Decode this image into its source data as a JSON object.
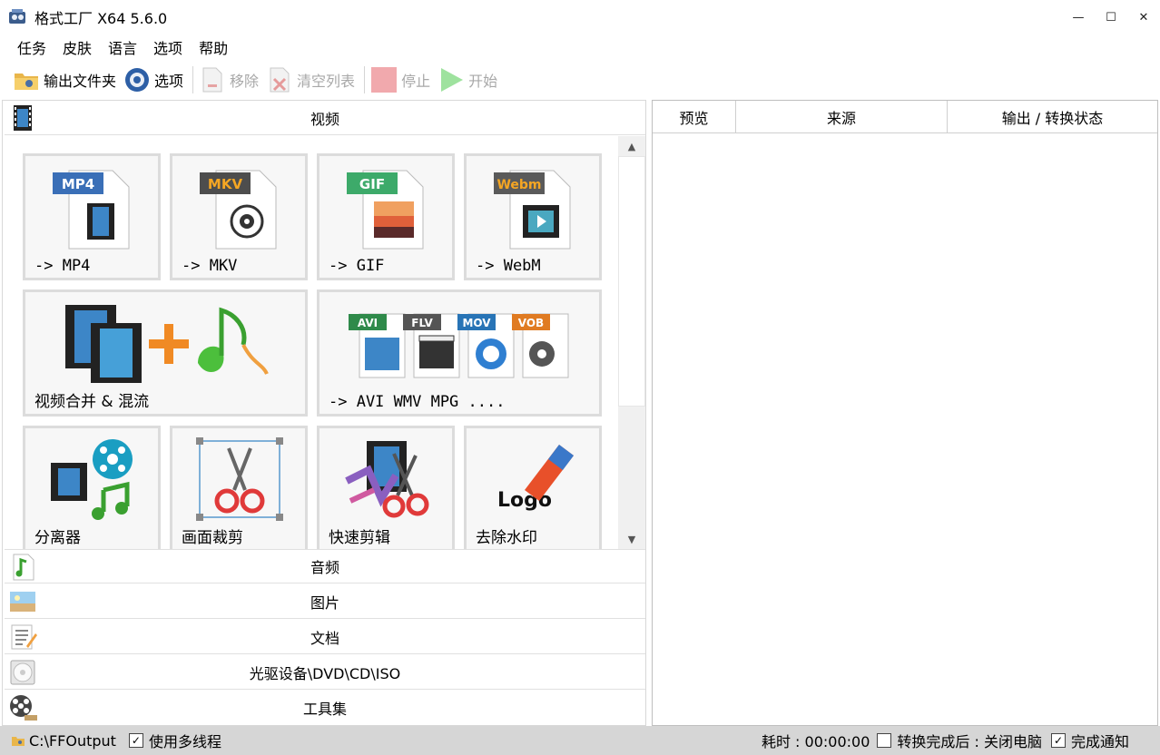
{
  "window": {
    "title": "格式工厂 X64 5.6.0",
    "minimize": "—",
    "maximize": "☐",
    "close": "✕"
  },
  "menu": [
    "任务",
    "皮肤",
    "语言",
    "选项",
    "帮助"
  ],
  "toolbar": {
    "output_folder": "输出文件夹",
    "options": "选项",
    "remove": "移除",
    "clear_list": "清空列表",
    "stop": "停止",
    "start": "开始"
  },
  "categories": {
    "video": "视频",
    "audio": "音频",
    "image": "图片",
    "document": "文档",
    "disc": "光驱设备\\DVD\\CD\\ISO",
    "tools": "工具集"
  },
  "tiles": {
    "mp4": {
      "badge": "MP4",
      "label": "-> MP4"
    },
    "mkv": {
      "badge": "MKV",
      "label": "-> MKV"
    },
    "gif": {
      "badge": "GIF",
      "label": "-> GIF"
    },
    "webm": {
      "badge": "Webm",
      "label": "-> WebM"
    },
    "merge": {
      "label": "视频合并 & 混流"
    },
    "others": {
      "badges": [
        "AVI",
        "FLV",
        "MOV",
        "VOB"
      ],
      "label": "-> AVI WMV MPG ...."
    },
    "splitter": {
      "label": "分离器"
    },
    "crop": {
      "label": "画面裁剪"
    },
    "quick_clip": {
      "label": "快速剪辑"
    },
    "remove_logo": {
      "logo_text": "Logo",
      "label": "去除水印"
    }
  },
  "table": {
    "columns": [
      "预览",
      "来源",
      "输出 / 转换状态"
    ]
  },
  "status": {
    "path": "C:\\FFOutput",
    "multithread": "使用多线程",
    "elapsed": "耗时 : 00:00:00",
    "after_done": "转换完成后 : 关闭电脑",
    "notify": "完成通知",
    "check": "✓"
  },
  "colors": {
    "mp4": "#3a6fb7",
    "mkv": "#4d4d4d",
    "gif": "#3daa6a",
    "webm": "#5a5a5a",
    "avi": "#2f8a4a",
    "flv": "#555555",
    "mov": "#2874b6",
    "vob": "#e07b22"
  }
}
